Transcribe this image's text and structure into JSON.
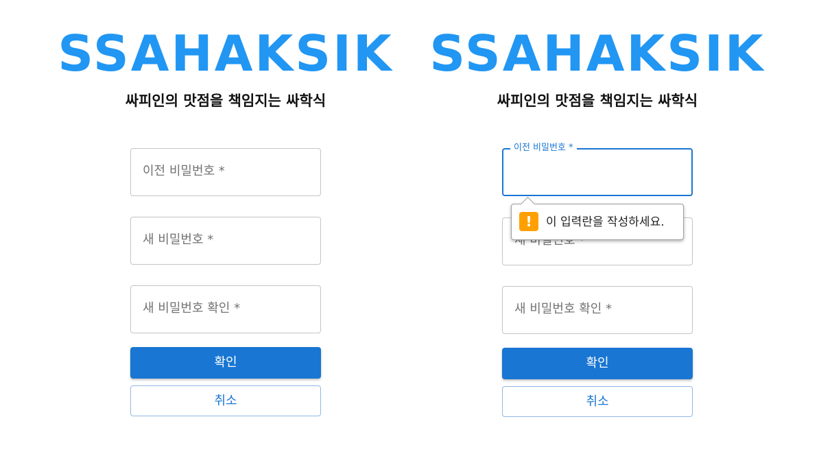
{
  "brand": {
    "logo_text": "SSAHAKSIK",
    "tagline": "싸피인의 맛점을 책임지는 싸학식",
    "accent_color": "#2196f3"
  },
  "form": {
    "old_password_label": "이전 비밀번호 *",
    "new_password_label": "새 비밀번호 *",
    "confirm_password_label": "새 비밀번호 확인 *",
    "old_password_value": "",
    "submit_label": "확인",
    "cancel_label": "취소",
    "primary_color": "#1976d2"
  },
  "validation_tooltip": {
    "icon": "warning-icon",
    "icon_glyph": "!",
    "message": "이 입력란을 작성하세요."
  }
}
